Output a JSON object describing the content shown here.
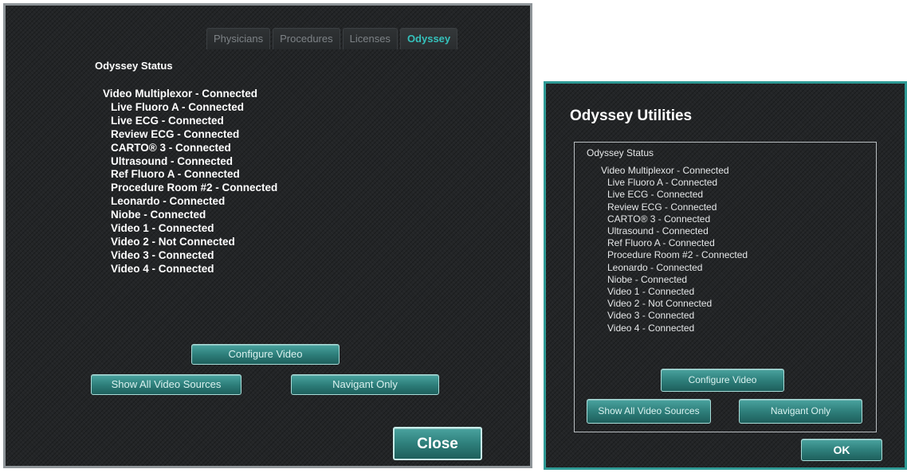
{
  "left_panel": {
    "tabs": [
      {
        "label": "Physicians",
        "active": false
      },
      {
        "label": "Procedures",
        "active": false
      },
      {
        "label": "Licenses",
        "active": false
      },
      {
        "label": "Odyssey",
        "active": true
      }
    ],
    "status_title": "Odyssey Status",
    "status_items": [
      {
        "text": "Video Multiplexor - Connected",
        "level": 0
      },
      {
        "text": "Live Fluoro A - Connected",
        "level": 1
      },
      {
        "text": "Live ECG - Connected",
        "level": 1
      },
      {
        "text": "Review ECG - Connected",
        "level": 1
      },
      {
        "text": "CARTO® 3 - Connected",
        "level": 1
      },
      {
        "text": "Ultrasound - Connected",
        "level": 1
      },
      {
        "text": "Ref Fluoro A - Connected",
        "level": 1
      },
      {
        "text": "Procedure Room #2 - Connected",
        "level": 1
      },
      {
        "text": "Leonardo - Connected",
        "level": 1
      },
      {
        "text": "Niobe - Connected",
        "level": 1
      },
      {
        "text": "Video 1 - Connected",
        "level": 1
      },
      {
        "text": "Video 2 - Not Connected",
        "level": 1
      },
      {
        "text": "Video 3 - Connected",
        "level": 1
      },
      {
        "text": "Video 4 - Connected",
        "level": 1
      }
    ],
    "buttons": {
      "configure_video": "Configure Video",
      "show_all_video_sources": "Show All Video Sources",
      "navigant_only": "Navigant Only",
      "close": "Close"
    }
  },
  "right_panel": {
    "title": "Odyssey Utilities",
    "status_title": "Odyssey Status",
    "status_items": [
      {
        "text": "Video Multiplexor - Connected",
        "level": 0
      },
      {
        "text": "Live Fluoro A - Connected",
        "level": 1
      },
      {
        "text": "Live ECG - Connected",
        "level": 1
      },
      {
        "text": "Review ECG - Connected",
        "level": 1
      },
      {
        "text": "CARTO® 3 - Connected",
        "level": 1
      },
      {
        "text": "Ultrasound - Connected",
        "level": 1
      },
      {
        "text": "Ref Fluoro A - Connected",
        "level": 1
      },
      {
        "text": "Procedure Room #2 - Connected",
        "level": 1
      },
      {
        "text": "Leonardo - Connected",
        "level": 1
      },
      {
        "text": "Niobe - Connected",
        "level": 1
      },
      {
        "text": "Video 1 - Connected",
        "level": 1
      },
      {
        "text": "Video 2 - Not Connected",
        "level": 1
      },
      {
        "text": "Video 3 - Connected",
        "level": 1
      },
      {
        "text": "Video 4 - Connected",
        "level": 1
      }
    ],
    "buttons": {
      "configure_video": "Configure Video",
      "show_all_video_sources": "Show All Video Sources",
      "navigant_only": "Navigant Only",
      "ok": "OK"
    }
  },
  "colors": {
    "panel_background": "#232527",
    "left_border": "#8f9599",
    "right_border": "#2e9a95",
    "accent_teal": "#35c2bc",
    "button_teal": "#2e7f7b"
  }
}
